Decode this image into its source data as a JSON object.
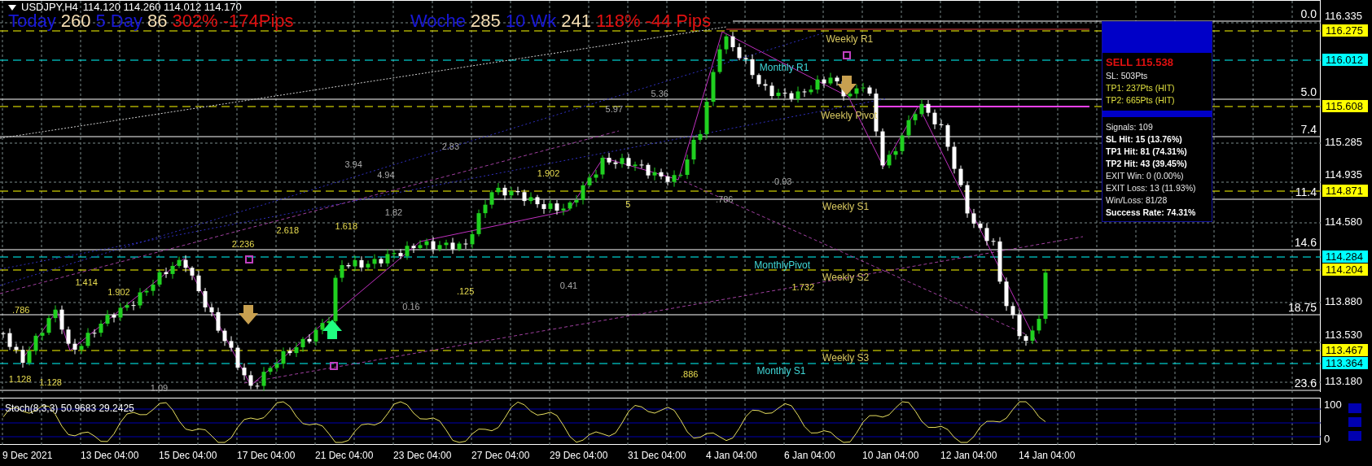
{
  "symbol": {
    "name": "USDJPY,H4",
    "ohlc": "114.120 114.260 114.012 114.170"
  },
  "stats_overlay": [
    {
      "text": "Today",
      "color": "#1818d8"
    },
    {
      "text": "260",
      "color": "#f5deb3"
    },
    {
      "text": "5 Day",
      "color": "#1818d8"
    },
    {
      "text": "86",
      "color": "#f5deb3"
    },
    {
      "text": "302%",
      "color": "#e01010"
    },
    {
      "text": "-174Pips",
      "color": "#e01010"
    },
    {
      "text": "Woche",
      "color": "#1818d8"
    },
    {
      "text": "285",
      "color": "#f5deb3"
    },
    {
      "text": "10 Wk",
      "color": "#1818d8"
    },
    {
      "text": "241",
      "color": "#f5deb3"
    },
    {
      "text": "118%",
      "color": "#e01010"
    },
    {
      "text": "-44",
      "color": "#e01010"
    },
    {
      "text": "Pips",
      "color": "#e01010"
    }
  ],
  "price_ticks": [
    "116.335",
    "115.285",
    "114.935",
    "114.580",
    "113.880",
    "113.530",
    "113.180"
  ],
  "price_levels": [
    {
      "price": "116.275",
      "color": "#ffff00"
    },
    {
      "price": "116.012",
      "color": "#00ffff"
    },
    {
      "price": "115.608",
      "color": "#ffff00"
    },
    {
      "price": "114.871",
      "color": "#ffff00"
    },
    {
      "price": "114.284",
      "color": "#00ffff"
    },
    {
      "price": "114.204",
      "color": "#ffff00"
    },
    {
      "price": "113.467",
      "color": "#ffff00"
    },
    {
      "price": "113.364",
      "color": "#00ffff"
    }
  ],
  "fib_levels": [
    "0.0",
    "5.0",
    "7.4",
    "11.4",
    "14.6",
    "18.75",
    "23.6"
  ],
  "pivot_labels": [
    {
      "text": "Weekly R1",
      "kind": "weekly"
    },
    {
      "text": "Monthly R1",
      "kind": "monthly"
    },
    {
      "text": "Weekly Pivot",
      "kind": "weekly"
    },
    {
      "text": "Weekly S1",
      "kind": "weekly"
    },
    {
      "text": "MonthlyPivot",
      "kind": "monthly"
    },
    {
      "text": "Weekly S2",
      "kind": "weekly"
    },
    {
      "text": "Weekly S3",
      "kind": "weekly"
    },
    {
      "text": "Monthly S1",
      "kind": "monthly"
    }
  ],
  "chart_labels": [
    {
      "text": "5.36",
      "kind": "level"
    },
    {
      "text": "5.97",
      "kind": "level"
    },
    {
      "text": "2.83",
      "kind": "level"
    },
    {
      "text": "3.94",
      "kind": "level"
    },
    {
      "text": "4.94",
      "kind": "level"
    },
    {
      "text": "1.902",
      "kind": "ratio"
    },
    {
      "text": "0.93",
      "kind": "level"
    },
    {
      "text": ".786",
      "kind": "level"
    },
    {
      "text": "5",
      "kind": "ratio"
    },
    {
      "text": "1.82",
      "kind": "level"
    },
    {
      "text": "1.618",
      "kind": "ratio"
    },
    {
      "text": "2.618",
      "kind": "ratio"
    },
    {
      "text": "2.236",
      "kind": "ratio"
    },
    {
      "text": "1.414",
      "kind": "ratio"
    },
    {
      "text": "1.902",
      "kind": "ratio"
    },
    {
      "text": "0.41",
      "kind": "level"
    },
    {
      "text": "1.732",
      "kind": "ratio"
    },
    {
      "text": ".125",
      "kind": "ratio"
    },
    {
      "text": "0.16",
      "kind": "level"
    },
    {
      "text": ".786",
      "kind": "ratio"
    },
    {
      "text": "1.128",
      "kind": "ratio"
    },
    {
      "text": "1.128",
      "kind": "ratio"
    },
    {
      "text": "1.09",
      "kind": "level"
    },
    {
      "text": ".886",
      "kind": "ratio"
    }
  ],
  "signal_panel": {
    "signal": "SELL 115.538",
    "sl": "SL: 503Pts",
    "targets": [
      "TP1: 237Pts (HIT)",
      "TP2: 665Pts (HIT)"
    ],
    "stats": [
      {
        "text": "Signals: 109",
        "bold": false
      },
      {
        "text": "SL Hit: 15 (13.76%)",
        "bold": true
      },
      {
        "text": "TP1 Hit: 81 (74.31%)",
        "bold": true
      },
      {
        "text": "TP2 Hit: 43 (39.45%)",
        "bold": true
      },
      {
        "text": "EXIT Win: 0 (0.00%)",
        "bold": false
      },
      {
        "text": "EXIT Loss: 13 (11.93%)",
        "bold": false
      },
      {
        "text": "Win/Loss: 81/28",
        "bold": false
      },
      {
        "text": "Success Rate: 74.31%",
        "bold": true
      }
    ]
  },
  "stochastic": {
    "label": "Stoch(8,3,3) 50.9683 29.2425",
    "scale": [
      "100",
      "0"
    ]
  },
  "time_axis": [
    "9 Dec 2021",
    "13 Dec 04:00",
    "15 Dec 04:00",
    "17 Dec 04:00",
    "21 Dec 04:00",
    "23 Dec 04:00",
    "27 Dec 04:00",
    "29 Dec 04:00",
    "31 Dec 04:00",
    "4 Jan 04:00",
    "6 Jan 04:00",
    "10 Jan 04:00",
    "12 Jan 04:00",
    "14 Jan 04:00"
  ]
}
